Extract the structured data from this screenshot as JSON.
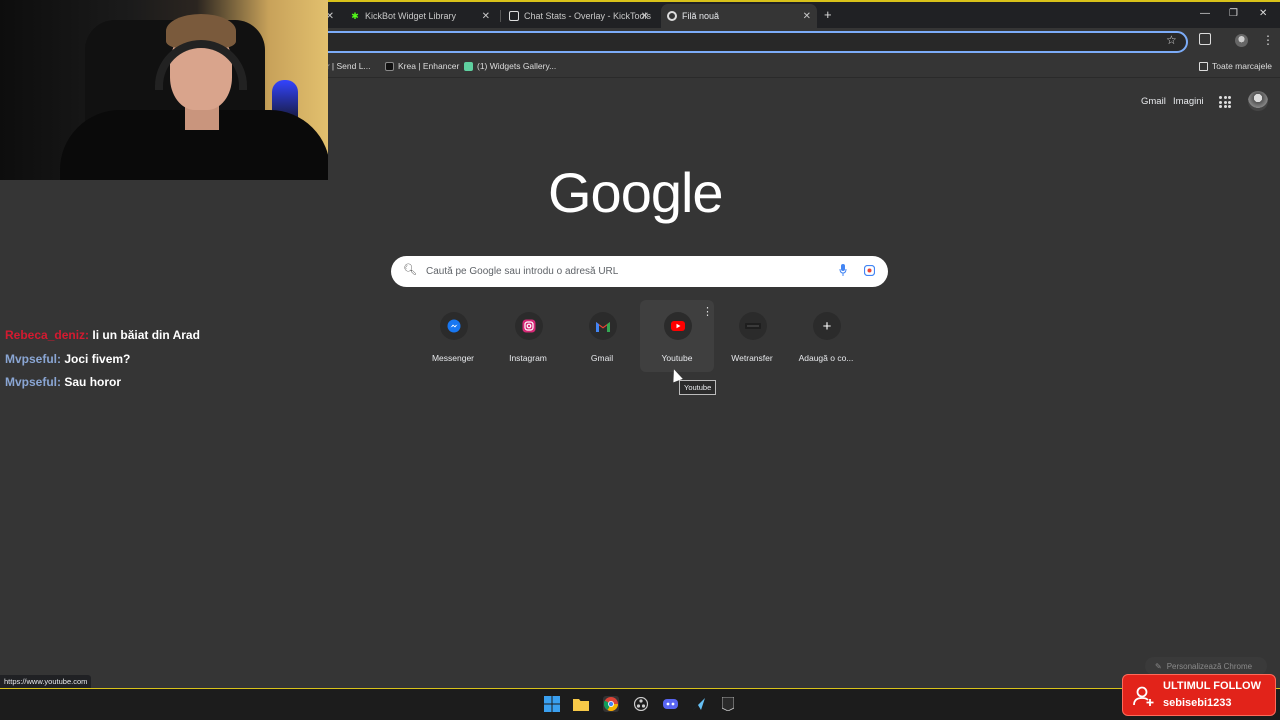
{
  "browser": {
    "tabs": [
      {
        "title": "KickBot Widget Library",
        "favicon": "kickbot-icon"
      },
      {
        "title": "Chat Stats - Overlay - KickTools",
        "favicon": "kicktools-icon"
      },
      {
        "title": "Filă nouă",
        "favicon": "chrome-icon",
        "active": true
      }
    ],
    "new_tab_glyph": "+",
    "bookmarks": [
      {
        "label": "er | Send L..."
      },
      {
        "label": "Krea | Enhancer"
      },
      {
        "label": "(1) Widgets Gallery..."
      }
    ],
    "all_bookmarks_label": "Toate marcajele",
    "status_url": "https://www.youtube.com"
  },
  "ntp": {
    "gmail_link": "Gmail",
    "images_link": "Imagini",
    "logo_text": "Google",
    "search_placeholder": "Caută pe Google sau introdu o adresă URL",
    "shortcuts": [
      {
        "label": "Messenger",
        "icon": "messenger-icon"
      },
      {
        "label": "Instagram",
        "icon": "instagram-icon"
      },
      {
        "label": "Gmail",
        "icon": "gmail-icon"
      },
      {
        "label": "Youtube",
        "icon": "youtube-icon"
      },
      {
        "label": "Wetransfer",
        "icon": "wetransfer-icon"
      },
      {
        "label": "Adaugă o co...",
        "icon": "plus-icon"
      }
    ],
    "tooltip": "Youtube",
    "customize_label": "Personalizează Chrome"
  },
  "chat": [
    {
      "user": "Rebeca_deniz:",
      "message": "Ii un băiat din Arad"
    },
    {
      "user": "Mvpseful:",
      "message": "Joci fivem?"
    },
    {
      "user": "Mvpseful:",
      "message": "Sau horor"
    }
  ],
  "follow_alert": {
    "title": "ULTIMUL FOLLOW",
    "username": "sebisebi1233"
  },
  "colors": {
    "accent_blue": "#7cacf8",
    "alert_red": "#e2231a",
    "chat_user": "#8aa6d4",
    "chat_user_red": "#d41a30"
  }
}
